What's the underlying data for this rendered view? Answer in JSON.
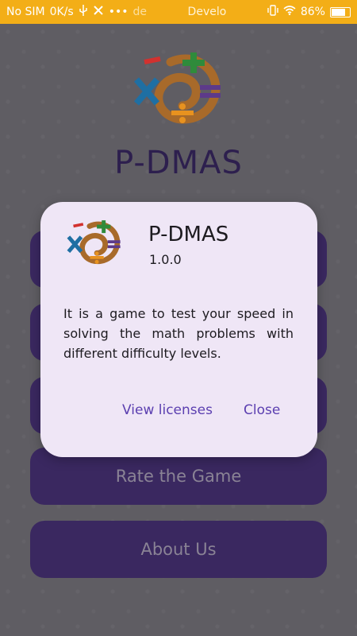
{
  "status_bar": {
    "carrier": "No SIM",
    "speed": "0K/s",
    "overflow": "•••",
    "mode_text": "Develo",
    "mode_text_prefix": "de",
    "battery": "86%",
    "color": "#f3ae17"
  },
  "app": {
    "title": "P-DMAS",
    "menu": {
      "rate": "Rate the Game",
      "about": "About Us"
    }
  },
  "about_dialog": {
    "name": "P-DMAS",
    "version": "1.0.0",
    "description": "It is a game to test your speed in solving the math problems with different difficulty levels.",
    "view_licenses": "View licenses",
    "close": "Close"
  },
  "icons": [
    "usb-icon",
    "developer-tools-icon",
    "vibrate-icon",
    "wifi-icon",
    "battery-icon",
    "app-logo-icon"
  ]
}
